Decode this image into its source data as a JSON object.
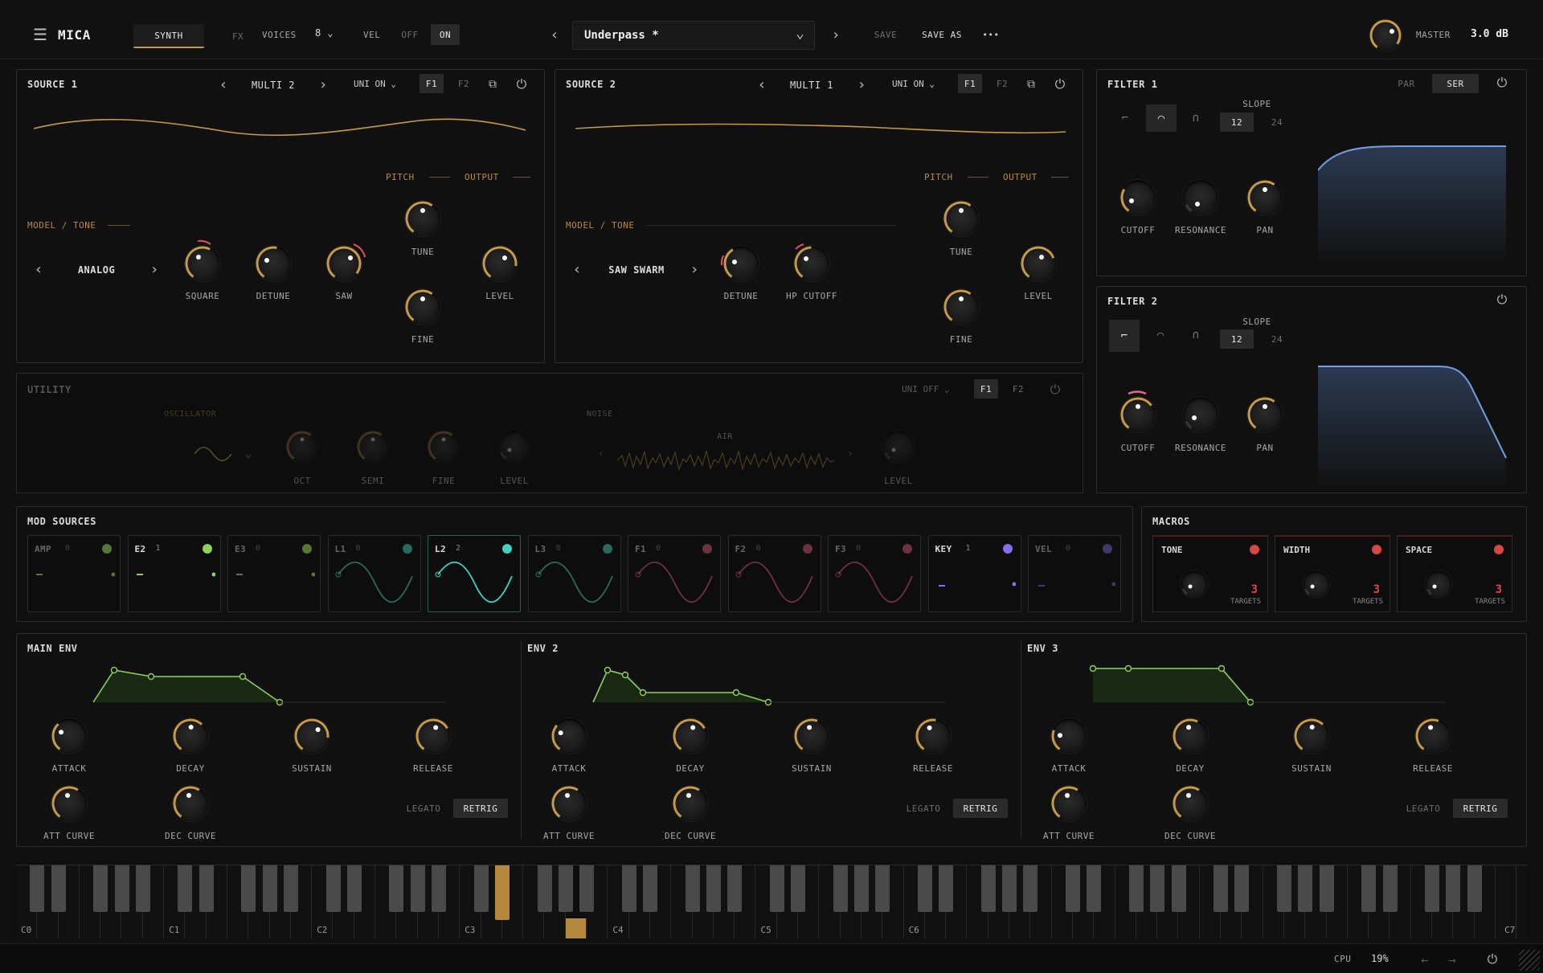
{
  "app": {
    "name": "MICA",
    "tabs": [
      "SYNTH",
      "FX"
    ],
    "voices_label": "VOICES",
    "voices_value": "8",
    "vel_label": "VEL",
    "vel_off": "OFF",
    "vel_on": "ON",
    "preset": "Underpass *",
    "save": "SAVE",
    "save_as": "SAVE AS",
    "more": "•••",
    "master_label": "MASTER",
    "master_value": "3.0 dB"
  },
  "source1": {
    "title": "SOURCE 1",
    "wave": "MULTI 2",
    "uni": "UNI ON",
    "f1": "F1",
    "f2": "F2",
    "pitch": "PITCH",
    "output": "OUTPUT",
    "model_tone": "MODEL / TONE",
    "model": "ANALOG",
    "knobs": [
      "SQUARE",
      "DETUNE",
      "SAW"
    ],
    "tune": "TUNE",
    "fine": "FINE",
    "level": "LEVEL"
  },
  "source2": {
    "title": "SOURCE 2",
    "wave": "MULTI 1",
    "uni": "UNI ON",
    "f1": "F1",
    "f2": "F2",
    "pitch": "PITCH",
    "output": "OUTPUT",
    "model_tone": "MODEL / TONE",
    "model": "SAW SWARM",
    "knobs": [
      "DETUNE",
      "HP CUTOFF"
    ],
    "tune": "TUNE",
    "fine": "FINE",
    "level": "LEVEL"
  },
  "utility": {
    "title": "UTILITY",
    "uni": "UNI OFF",
    "f1": "F1",
    "f2": "F2",
    "oscillator": "OSCILLATOR",
    "noise": "NOISE",
    "air": "AIR",
    "knobs": [
      "OCT",
      "SEMI",
      "FINE",
      "LEVEL"
    ],
    "noise_level": "LEVEL"
  },
  "filter1": {
    "title": "FILTER 1",
    "par": "PAR",
    "ser": "SER",
    "slope": "SLOPE",
    "slope_a": "12",
    "slope_b": "24",
    "knobs": [
      "CUTOFF",
      "RESONANCE",
      "PAN"
    ]
  },
  "filter2": {
    "title": "FILTER 2",
    "slope": "SLOPE",
    "slope_a": "12",
    "slope_b": "24",
    "knobs": [
      "CUTOFF",
      "RESONANCE",
      "PAN"
    ]
  },
  "mod": {
    "title": "MOD SOURCES",
    "items": [
      {
        "name": "AMP",
        "count": "0",
        "color": "#8fd05a"
      },
      {
        "name": "E2",
        "count": "1",
        "color": "#8fd05a"
      },
      {
        "name": "E3",
        "count": "0",
        "color": "#8fd05a"
      },
      {
        "name": "L1",
        "count": "0",
        "color": "#3fb8a0"
      },
      {
        "name": "L2",
        "count": "2",
        "color": "#3fd2c0"
      },
      {
        "name": "L3",
        "count": "0",
        "color": "#3fb8a0"
      },
      {
        "name": "F1",
        "count": "0",
        "color": "#c0506a"
      },
      {
        "name": "F2",
        "count": "0",
        "color": "#c0506a"
      },
      {
        "name": "F3",
        "count": "0",
        "color": "#c0506a"
      },
      {
        "name": "KEY",
        "count": "1",
        "color": "#8a6cf0"
      },
      {
        "name": "VEL",
        "count": "0",
        "color": "#6a5cc0"
      }
    ]
  },
  "macros": {
    "title": "MACROS",
    "items": [
      {
        "name": "TONE",
        "targets": "3",
        "targets_label": "TARGETS"
      },
      {
        "name": "WIDTH",
        "targets": "3",
        "targets_label": "TARGETS"
      },
      {
        "name": "SPACE",
        "targets": "3",
        "targets_label": "TARGETS"
      }
    ]
  },
  "envs": [
    {
      "title": "MAIN ENV",
      "knobs": [
        "ATTACK",
        "DECAY",
        "SUSTAIN",
        "RELEASE"
      ],
      "curves": [
        "ATT CURVE",
        "DEC CURVE"
      ],
      "legato": "LEGATO",
      "retrig": "RETRIG"
    },
    {
      "title": "ENV 2",
      "knobs": [
        "ATTACK",
        "DECAY",
        "SUSTAIN",
        "RELEASE"
      ],
      "curves": [
        "ATT CURVE",
        "DEC CURVE"
      ],
      "legato": "LEGATO",
      "retrig": "RETRIG"
    },
    {
      "title": "ENV 3",
      "knobs": [
        "ATTACK",
        "DECAY",
        "SUSTAIN",
        "RELEASE"
      ],
      "curves": [
        "ATT CURVE",
        "DEC CURVE"
      ],
      "legato": "LEGATO",
      "retrig": "RETRIG"
    }
  ],
  "keyboard": {
    "octaves": [
      "C0",
      "C1",
      "C2",
      "C3",
      "C4",
      "C5",
      "C6",
      "C7"
    ]
  },
  "status": {
    "cpu_label": "CPU",
    "cpu_value": "19%"
  },
  "colors": {
    "accent": "#c69a47",
    "env": "#8fd05a",
    "filter": "#6f9fe0"
  }
}
